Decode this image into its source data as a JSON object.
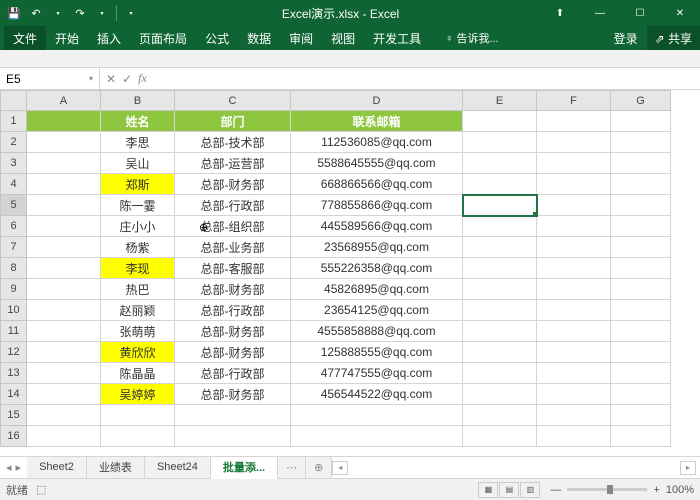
{
  "title": "Excel演示.xlsx - Excel",
  "qat": {
    "save": "💾",
    "undo": "↶",
    "redo": "↷"
  },
  "win": {
    "min": "—",
    "max": "☐",
    "close": "✕",
    "user": "⬆"
  },
  "tabs": {
    "file": "文件",
    "home": "开始",
    "insert": "插入",
    "layout": "页面布局",
    "formula": "公式",
    "data": "数据",
    "review": "审阅",
    "view": "视图",
    "dev": "开发工具",
    "tell": "♀ 告诉我...",
    "login": "登录",
    "share": "⇗ 共享"
  },
  "namebox": "E5",
  "fx": {
    "x": "✕",
    "check": "✓",
    "fx": "fx"
  },
  "cols": [
    "A",
    "B",
    "C",
    "D",
    "E",
    "F",
    "G"
  ],
  "header": {
    "name": "姓名",
    "dept": "部门",
    "email": "联系邮箱"
  },
  "rows": [
    {
      "n": "李思",
      "d": "总部-技术部",
      "e": "112536085@qq.com",
      "hl": false
    },
    {
      "n": "吴山",
      "d": "总部-运营部",
      "e": "5588645555@qq.com",
      "hl": false
    },
    {
      "n": "郑斯",
      "d": "总部-财务部",
      "e": "668866566@qq.com",
      "hl": true
    },
    {
      "n": "陈一霎",
      "d": "总部-行政部",
      "e": "778855866@qq.com",
      "hl": false
    },
    {
      "n": "庄小小",
      "d": "总部-组织部",
      "e": "445589566@qq.com",
      "hl": false
    },
    {
      "n": "杨紫",
      "d": "总部-业务部",
      "e": "23568955@qq.com",
      "hl": false
    },
    {
      "n": "李现",
      "d": "总部-客服部",
      "e": "555226358@qq.com",
      "hl": true
    },
    {
      "n": "热巴",
      "d": "总部-财务部",
      "e": "45826895@qq.com",
      "hl": false
    },
    {
      "n": "赵丽颖",
      "d": "总部-行政部",
      "e": "23654125@qq.com",
      "hl": false
    },
    {
      "n": "张萌萌",
      "d": "总部-财务部",
      "e": "4555858888@qq.com",
      "hl": false
    },
    {
      "n": "黄欣欣",
      "d": "总部-财务部",
      "e": "125888555@qq.com",
      "hl": true
    },
    {
      "n": "陈晶晶",
      "d": "总部-行政部",
      "e": "477747555@qq.com",
      "hl": false
    },
    {
      "n": "吴婷婷",
      "d": "总部-财务部",
      "e": "456544522@qq.com",
      "hl": true
    }
  ],
  "sheets": {
    "nav": {
      "first": "|◂",
      "prev": "◂",
      "next": "▸",
      "last": "▸|"
    },
    "list": [
      "Sheet2",
      "业绩表",
      "Sheet24",
      "批量添..."
    ],
    "active": 3,
    "add": "⊕",
    "more": "⋯"
  },
  "status": {
    "ready": "就绪",
    "rec": "⬚",
    "views": {
      "normal": "▦",
      "layout": "▤",
      "break": "▥"
    },
    "zminus": "—",
    "zplus": "+",
    "zoom": "100%"
  }
}
